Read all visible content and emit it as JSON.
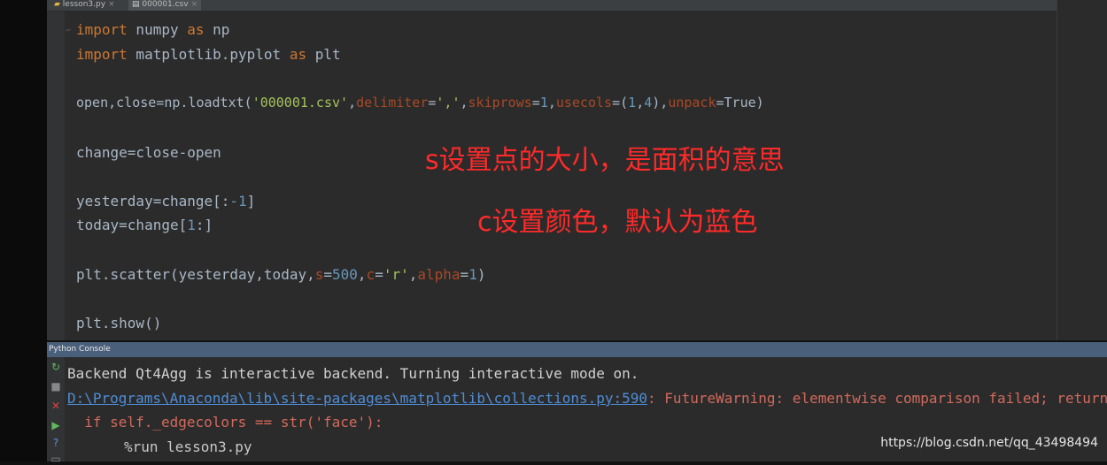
{
  "tabs": [
    {
      "label": "lesson3.py",
      "close": "×"
    },
    {
      "label": "000001.csv",
      "close": "×"
    }
  ],
  "code": {
    "l1": {
      "kw1": "import",
      "rest": " numpy ",
      "kw2": "as",
      "rest2": " np"
    },
    "l2": {
      "kw1": "import",
      "rest": " matplotlib.pyplot ",
      "kw2": "as",
      "rest2": " plt"
    },
    "l3": {
      "a": "open,close=np.loadtxt(",
      "s1": "'000001.csv'",
      "b": ",",
      "p1": "delimiter",
      "c": "=",
      "s2": "','",
      "d": ",",
      "p2": "skiprows",
      "e": "=",
      "n1": "1",
      "f": ",",
      "p3": "usecols",
      "g": "=(",
      "n2": "1",
      "h": ",",
      "n3": "4",
      "i": "),",
      "p4": "unpack",
      "j": "=True)"
    },
    "l4": "change=close-open",
    "l5": {
      "a": "yesterday=change[:",
      "n": "-1",
      "b": "]"
    },
    "l6": {
      "a": "today=change[",
      "n": "1",
      "b": ":]"
    },
    "l7": {
      "a": "plt.scatter(yesterday,today,",
      "p1": "s",
      "b": "=",
      "n1": "500",
      "c": ",",
      "p2": "c",
      "d": "=",
      "s1": "'r'",
      "e": ",",
      "p3": "alpha",
      "f": "=",
      "n2": "1",
      "g": ")"
    },
    "l8": "plt.show()"
  },
  "captions": {
    "line1": "s设置点的大小，是面积的意思",
    "line2": "c设置颜色，默认为蓝色"
  },
  "console": {
    "title": "Python Console",
    "line1": "Backend Qt4Agg is interactive backend. Turning interactive mode on.",
    "line2_path": "D:\\Programs\\Anaconda\\lib\\site-packages\\matplotlib\\collections.py:590",
    "line2_msg": ": FutureWarning: elementwise comparison failed; returning sc",
    "line3": "  if self._edgecolors == str('face'):",
    "line4": "%run lesson3.py"
  },
  "watermark": "https://blog.csdn.net/qq_43498494",
  "colors": {
    "keyword": "#cc7832",
    "string": "#a5c25c",
    "named_param": "#aa4926",
    "number": "#6897bb",
    "caption": "#ff2a2a",
    "warning": "#d26a5c",
    "link": "#4f8dd6"
  }
}
